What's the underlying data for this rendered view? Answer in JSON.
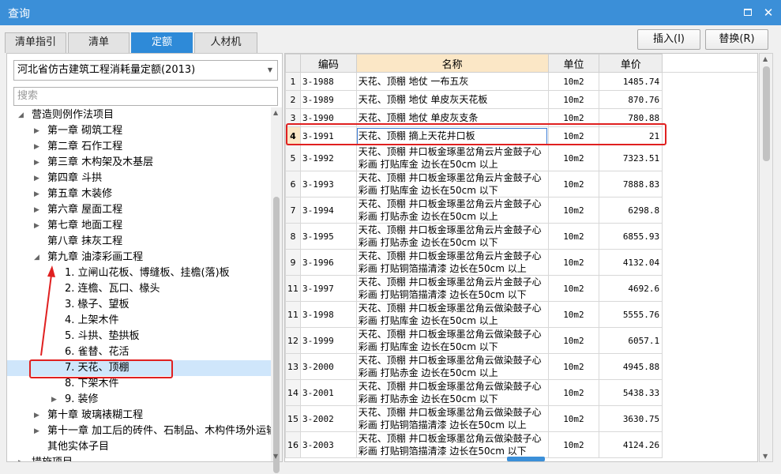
{
  "window": {
    "title": "查询",
    "maximize_icon": "maximize-icon",
    "close_icon": "close-icon",
    "close_glyph": "✕"
  },
  "tabs": [
    "清单指引",
    "清单",
    "定额",
    "人材机"
  ],
  "active_tab": 2,
  "buttons": {
    "insert": "插入(I)",
    "replace": "替换(R)"
  },
  "left": {
    "quota_library": "河北省仿古建筑工程消耗量定额(2013)",
    "search_placeholder": "搜索",
    "tree": [
      {
        "label": "营造则例作法项目",
        "level": 0,
        "state": "expanded"
      },
      {
        "label": "第一章 砌筑工程",
        "level": 1,
        "state": "collapsed"
      },
      {
        "label": "第二章 石作工程",
        "level": 1,
        "state": "collapsed"
      },
      {
        "label": "第三章 木构架及木基层",
        "level": 1,
        "state": "collapsed"
      },
      {
        "label": "第四章 斗拱",
        "level": 1,
        "state": "collapsed"
      },
      {
        "label": "第五章 木装修",
        "level": 1,
        "state": "collapsed"
      },
      {
        "label": "第六章 屋面工程",
        "level": 1,
        "state": "collapsed"
      },
      {
        "label": "第七章 地面工程",
        "level": 1,
        "state": "collapsed"
      },
      {
        "label": "第八章 抹灰工程",
        "level": 1,
        "state": "leaf"
      },
      {
        "label": "第九章 油漆彩画工程",
        "level": 1,
        "state": "expanded"
      },
      {
        "label": "1. 立闸山花板、博缝板、挂檐(落)板",
        "level": 2,
        "state": "leaf"
      },
      {
        "label": "2. 连檐、瓦口、椽头",
        "level": 2,
        "state": "leaf"
      },
      {
        "label": "3. 椽子、望板",
        "level": 2,
        "state": "leaf"
      },
      {
        "label": "4. 上架木件",
        "level": 2,
        "state": "leaf"
      },
      {
        "label": "5. 斗拱、垫拱板",
        "level": 2,
        "state": "leaf"
      },
      {
        "label": "6. 雀替、花活",
        "level": 2,
        "state": "leaf"
      },
      {
        "label": "7. 天花、顶棚",
        "level": 2,
        "state": "leaf",
        "selected": true
      },
      {
        "label": "8. 下架木件",
        "level": 2,
        "state": "leaf"
      },
      {
        "label": "9. 装修",
        "level": 2,
        "state": "collapsed"
      },
      {
        "label": "第十章 玻璃裱糊工程",
        "level": 1,
        "state": "collapsed"
      },
      {
        "label": "第十一章 加工后的砖件、石制品、木构件场外运输",
        "level": 1,
        "state": "collapsed"
      },
      {
        "label": "其他实体子目",
        "level": 1,
        "state": "leaf"
      },
      {
        "label": "措施项目",
        "level": 0,
        "state": "collapsed"
      }
    ]
  },
  "grid": {
    "columns": [
      "编码",
      "名称",
      "单位",
      "单价"
    ],
    "rows": [
      {
        "no": "1",
        "code": "3-1988",
        "name": "天花、顶棚 地仗 一布五灰",
        "unit": "10m2",
        "price": "1485.74"
      },
      {
        "no": "2",
        "code": "3-1989",
        "name": "天花、顶棚 地仗 单皮灰天花板",
        "unit": "10m2",
        "price": "870.76"
      },
      {
        "no": "3",
        "code": "3-1990",
        "name": "天花、顶棚 地仗 单皮灰支条",
        "unit": "10m2",
        "price": "780.88"
      },
      {
        "no": "4",
        "code": "3-1991",
        "name": "天花、顶棚 摘上天花井口板",
        "unit": "10m2",
        "price": "21",
        "active": true
      },
      {
        "no": "5",
        "code": "3-1992",
        "name": "天花、顶棚 井口板金琢墨岔角云片金鼓子心彩画 打贴库金 边长在50cm 以上",
        "unit": "10m2",
        "price": "7323.51"
      },
      {
        "no": "6",
        "code": "3-1993",
        "name": "天花、顶棚 井口板金琢墨岔角云片金鼓子心彩画 打贴库金 边长在50cm 以下",
        "unit": "10m2",
        "price": "7888.83"
      },
      {
        "no": "7",
        "code": "3-1994",
        "name": "天花、顶棚 井口板金琢墨岔角云片金鼓子心彩画 打贴赤金 边长在50cm 以上",
        "unit": "10m2",
        "price": "6298.8"
      },
      {
        "no": "8",
        "code": "3-1995",
        "name": "天花、顶棚 井口板金琢墨岔角云片金鼓子心彩画 打贴赤金 边长在50cm 以下",
        "unit": "10m2",
        "price": "6855.93"
      },
      {
        "no": "9",
        "code": "3-1996",
        "name": "天花、顶棚 井口板金琢墨岔角云片金鼓子心彩画 打贴铜箔描清漆 边长在50cm 以上",
        "unit": "10m2",
        "price": "4132.04"
      },
      {
        "no": "11",
        "code": "3-1997",
        "name": "天花、顶棚 井口板金琢墨岔角云片金鼓子心彩画 打贴铜箔描清漆 边长在50cm 以下",
        "unit": "10m2",
        "price": "4692.6"
      },
      {
        "no": "11",
        "code": "3-1998",
        "name": "天花、顶棚 井口板金琢墨岔角云做染鼓子心彩画 打贴库金 边长在50cm 以上",
        "unit": "10m2",
        "price": "5555.76"
      },
      {
        "no": "12",
        "code": "3-1999",
        "name": "天花、顶棚 井口板金琢墨岔角云做染鼓子心彩画 打贴库金 边长在50cm 以下",
        "unit": "10m2",
        "price": "6057.1"
      },
      {
        "no": "13",
        "code": "3-2000",
        "name": "天花、顶棚 井口板金琢墨岔角云做染鼓子心彩画 打贴赤金 边长在50cm 以上",
        "unit": "10m2",
        "price": "4945.88"
      },
      {
        "no": "14",
        "code": "3-2001",
        "name": "天花、顶棚 井口板金琢墨岔角云做染鼓子心彩画 打贴赤金 边长在50cm 以下",
        "unit": "10m2",
        "price": "5438.33"
      },
      {
        "no": "15",
        "code": "3-2002",
        "name": "天花、顶棚 井口板金琢墨岔角云做染鼓子心彩画 打贴铜箔描清漆 边长在50cm 以上",
        "unit": "10m2",
        "price": "3630.75"
      },
      {
        "no": "16",
        "code": "3-2003",
        "name": "天花、顶棚 井口板金琢墨岔角云做染鼓子心彩画 打贴铜箔描清漆 边长在50cm 以下",
        "unit": "10m2",
        "price": "4124.26"
      }
    ]
  },
  "colors": {
    "accent": "#2e8ad8",
    "titlebar": "#3b8fd8",
    "highlight": "#e02020",
    "selected_row": "#cfe6fb",
    "header_selected": "#fbe7c6"
  }
}
